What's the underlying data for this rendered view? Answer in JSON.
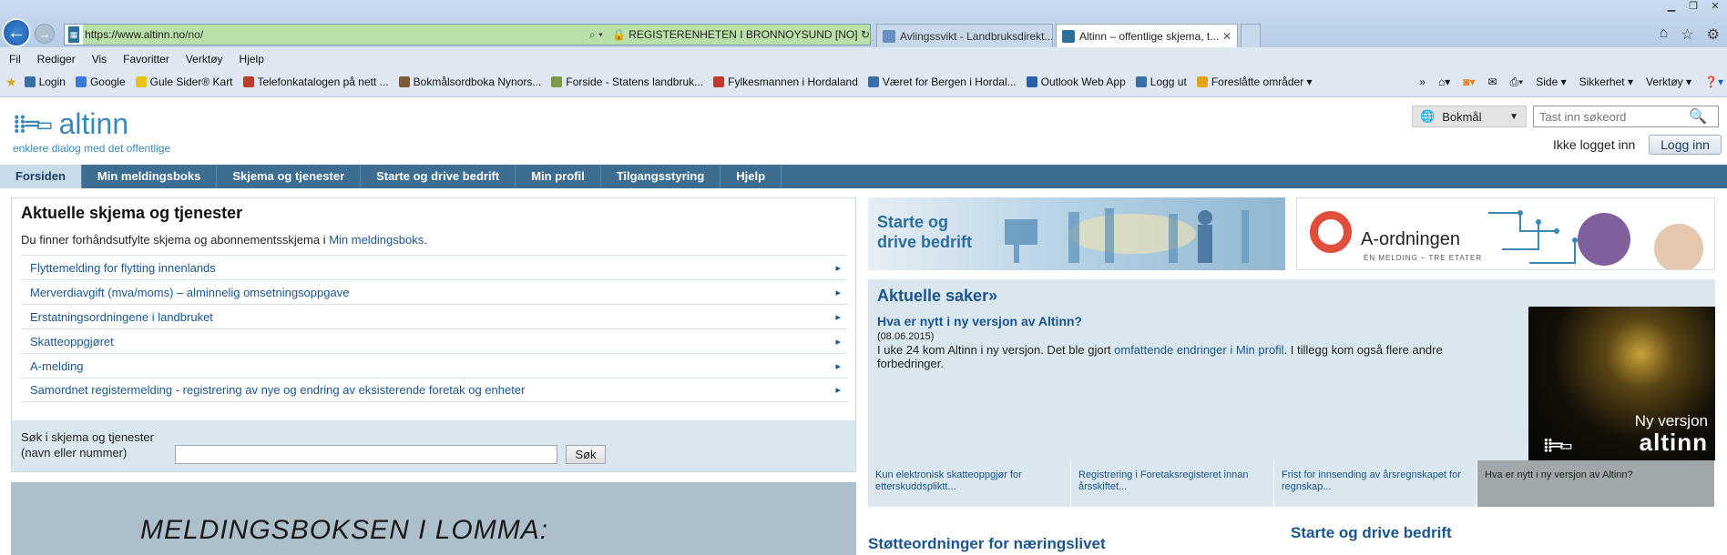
{
  "browser": {
    "url_domain": "https://www.altinn.no",
    "url_path": "/no/",
    "cert_label": "REGISTERENHETEN I BRONNOYSUND [NO]",
    "tabs": [
      {
        "label": "Avlingssvikt - Landbruksdirekt..."
      },
      {
        "label": "Altinn – offentlige skjema, t..."
      }
    ],
    "menu": [
      "Fil",
      "Rediger",
      "Vis",
      "Favoritter",
      "Verktøy",
      "Hjelp"
    ],
    "favorites": [
      {
        "label": "Login",
        "color": "#3b6ea5"
      },
      {
        "label": "Google",
        "color": "#3d7bdb"
      },
      {
        "label": "Gule Sider® Kart",
        "color": "#e8c21a"
      },
      {
        "label": "Telefonkatalogen på nett ...",
        "color": "#c0392b"
      },
      {
        "label": "Bokmålsordboka  Nynors...",
        "color": "#7c5a3a"
      },
      {
        "label": "Forside - Statens landbruk...",
        "color": "#7a9a4a"
      },
      {
        "label": "Fylkesmannen i Hordaland",
        "color": "#c0392b"
      },
      {
        "label": "Været for Bergen i Hordal...",
        "color": "#3b6ea5"
      },
      {
        "label": "Outlook Web App",
        "color": "#2a5ea8"
      },
      {
        "label": "Logg ut",
        "color": "#3b6ea5"
      },
      {
        "label": "Foreslåtte områder ▾",
        "color": "#e8a21a"
      }
    ],
    "toolbar": [
      "Side ▾",
      "Sikkerhet ▾",
      "Verktøy ▾"
    ]
  },
  "site": {
    "logo_text": "altinn",
    "logo_mark": "⁞⁞═▭",
    "tagline": "enklere dialog med det offentlige",
    "language": "Bokmål",
    "search_placeholder": "Tast inn søkeord",
    "login_status": "Ikke logget inn",
    "login_button": "Logg inn",
    "nav": [
      "Forsiden",
      "Min meldingsboks",
      "Skjema og tjenester",
      "Starte og drive bedrift",
      "Min profil",
      "Tilgangsstyring",
      "Hjelp"
    ]
  },
  "forms_panel": {
    "heading": "Aktuelle skjema og tjenester",
    "intro_text": "Du finner forhåndsutfylte skjema og abonnementsskjema i ",
    "intro_link": "Min meldingsboks",
    "intro_end": ".",
    "items": [
      "Flyttemelding for flytting innenlands",
      "Merverdiavgift (mva/moms) – alminnelig omsetningsoppgave",
      "Erstatningsordningene i landbruket",
      "Skatteoppgjøret",
      "A-melding",
      "Samordnet registermelding - registrering av nye og endring av eksisterende foretak og enheter"
    ],
    "search_label_1": "Søk i skjema og tjenester",
    "search_label_2": "(navn eller nummer)",
    "search_button": "Søk"
  },
  "promo": {
    "text": "MELDINGSBOKSEN I LOMMA:"
  },
  "banners": {
    "start_line1": "Starte og",
    "start_line2": "drive bedrift",
    "aord_title": "A-ordningen",
    "aord_sub": "ÉN MELDING – TRE ETATER"
  },
  "news": {
    "heading": "Aktuelle saker»",
    "title": "Hva er nytt i ny versjon av Altinn?",
    "date": "(08.06.2015)",
    "body_1": "I uke 24 kom Altinn i ny versjon. Det ble gjort ",
    "body_link": "omfattende endringer i Min profil",
    "body_2": ". I tillegg kom også flere andre forbedringer.",
    "image_line1": "Ny versjon",
    "image_line2": "altinn",
    "links": [
      "Kun elektronisk skatteoppgjør for etterskuddspliktt...",
      "Registrering i Foretaksregisteret innan årsskiftet...",
      "Frist for innsending av årsregnskapet for regnskap...",
      "Hva er nytt i ny versjon av Altinn?"
    ]
  },
  "bottom": {
    "stotte": "Støtteordninger for næringslivet",
    "start_drive": "Starte og drive bedrift"
  }
}
